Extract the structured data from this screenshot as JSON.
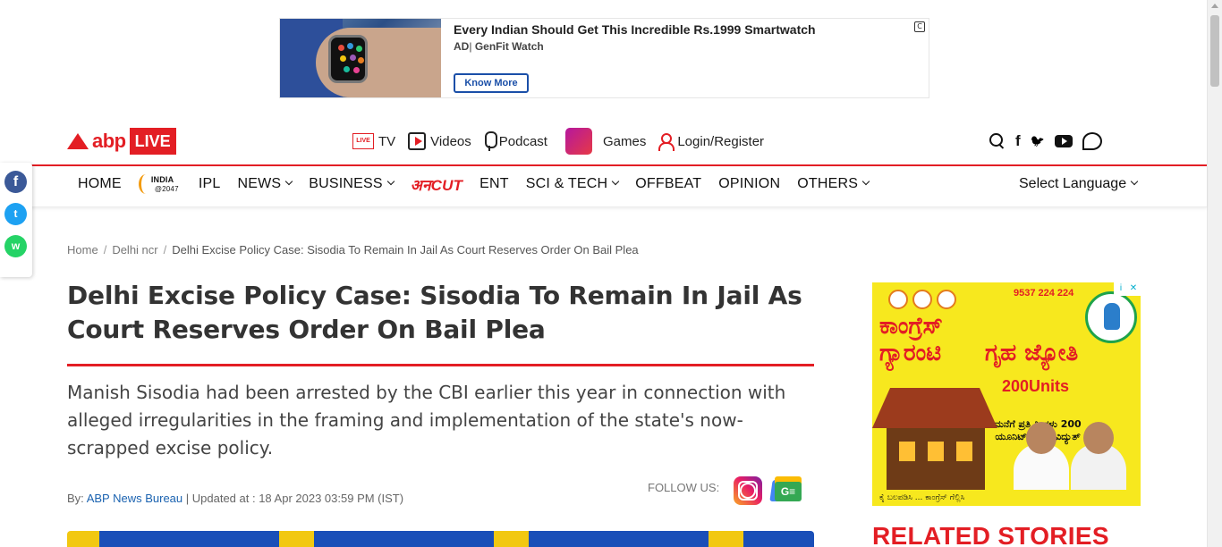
{
  "ad_banner": {
    "title": "Every Indian Should Get This Incredible Rs.1999 Smartwatch",
    "ad_tag": "AD",
    "sponsor": "GenFit Watch",
    "cta": "Know More",
    "adchoices": "C"
  },
  "brand": {
    "name": "abp",
    "live": "LIVE"
  },
  "top_nav": {
    "tv": "TV",
    "tv_badge": "LIVE",
    "videos": "Videos",
    "podcast": "Podcast",
    "games": "Games",
    "login": "Login/Register"
  },
  "top_social": {
    "facebook": "f",
    "twitter": "🐦"
  },
  "main_nav": {
    "home": "HOME",
    "india2047_line1": "INDIA",
    "india2047_line2": "@2047",
    "ipl": "IPL",
    "news": "NEWS",
    "business": "BUSINESS",
    "anecut": "अनCUT",
    "ent": "ENT",
    "scitech": "SCI & TECH",
    "offbeat": "OFFBEAT",
    "opinion": "OPINION",
    "others": "OTHERS",
    "language": "Select Language"
  },
  "share": {
    "facebook": "f",
    "twitter": "t",
    "whatsapp": "w"
  },
  "breadcrumb": {
    "home": "Home",
    "section": "Delhi ncr",
    "current": "Delhi Excise Policy Case: Sisodia To Remain In Jail As Court Reserves Order On Bail Plea"
  },
  "article": {
    "headline": "Delhi Excise Policy Case: Sisodia To Remain In Jail As Court Reserves Order On Bail Plea",
    "summary": "Manish Sisodia had been arrested by the CBI earlier this year in connection with alleged irregularities in the framing and implementation of the state's now-scrapped excise policy.",
    "by_label": "By:",
    "author": "ABP News Bureau",
    "updated_label": "| Updated at : 18 Apr 2023 03:59 PM (IST)",
    "follow_us": "FOLLOW US:",
    "gnews_label": "G≡"
  },
  "side_ad": {
    "phone": "9537 224 224",
    "headline_left": "ಕಾಂಗ್ರೆಸ್ ಗ್ಯಾರಂಟಿ",
    "headline_right": "ಗೃಹ ಜ್ಯೋತಿ",
    "units": "200Units",
    "sub": "ಮನೆಗೆ ಪ್ರತಿ ತಿಂಗಳು 200 ಯೂನಿಟ್ ಉಚಿತ ವಿದ್ಯುತ್",
    "footer": "ಕೈ ಬಲಪಡಿಸಿ ... ಕಾಂಗ್ರೆಸ್ ಗೆಲ್ಲಿಸಿ",
    "info": "i",
    "close": "✕"
  },
  "related": {
    "title": "RELATED STORIES"
  },
  "colors": {
    "brand_red": "#e31e24",
    "link_blue": "#1a62b0"
  }
}
